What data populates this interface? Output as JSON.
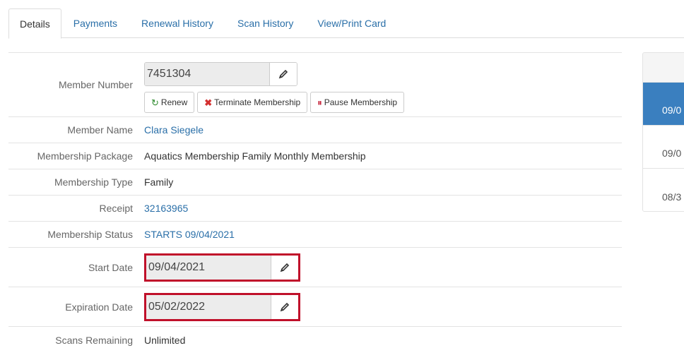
{
  "tabs": [
    "Details",
    "Payments",
    "Renewal History",
    "Scan History",
    "View/Print Card"
  ],
  "details": {
    "member_number": {
      "label": "Member Number",
      "value": "7451304"
    },
    "actions": {
      "renew": "Renew",
      "terminate": "Terminate Membership",
      "pause": "Pause Membership"
    },
    "member_name": {
      "label": "Member Name",
      "value": "Clara Siegele"
    },
    "package": {
      "label": "Membership Package",
      "value": "Aquatics Membership Family Monthly Membership"
    },
    "type": {
      "label": "Membership Type",
      "value": "Family"
    },
    "receipt": {
      "label": "Receipt",
      "value": "32163965"
    },
    "status": {
      "label": "Membership Status",
      "value": "STARTS 09/04/2021"
    },
    "start_date": {
      "label": "Start Date",
      "value": "09/04/2021"
    },
    "expiration_date": {
      "label": "Expiration Date",
      "value": "05/02/2022"
    },
    "scans_remaining": {
      "label": "Scans Remaining",
      "value": "Unlimited"
    }
  },
  "side_panel": {
    "items": [
      "09/0",
      "09/0",
      "08/3"
    ]
  },
  "colors": {
    "link": "#2a6fa8",
    "highlight": "#c0102a",
    "selected": "#3a7fbf"
  }
}
